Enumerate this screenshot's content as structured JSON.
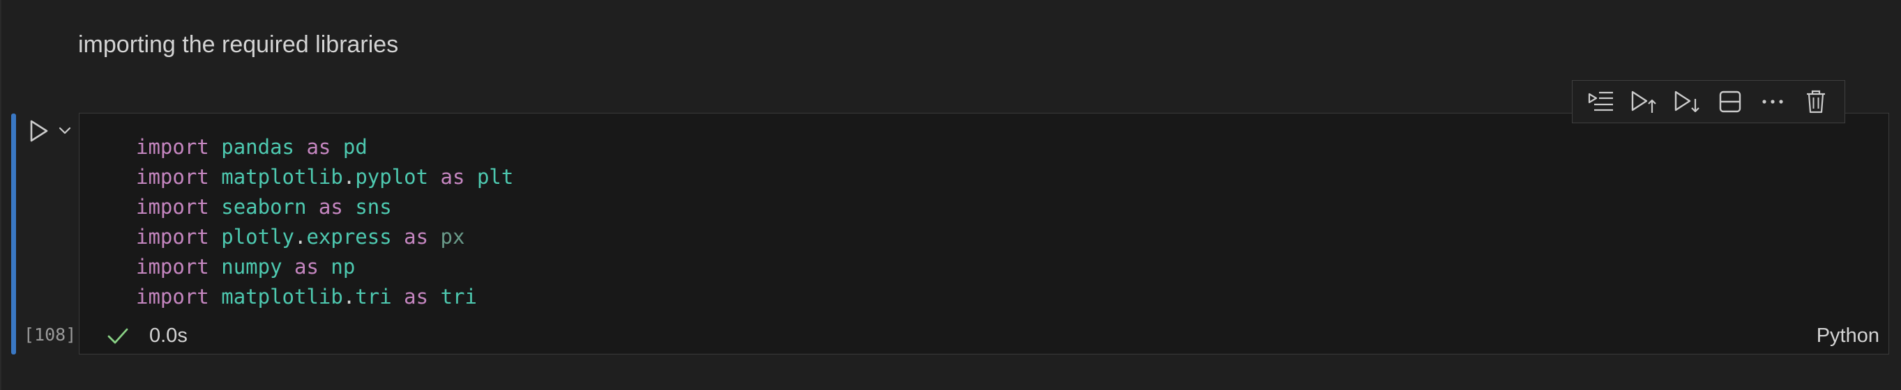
{
  "markdown": {
    "text": "importing the required libraries"
  },
  "code_cell": {
    "lines": [
      [
        {
          "t": "import",
          "c": "kw"
        },
        {
          "t": " ",
          "c": "punct"
        },
        {
          "t": "pandas",
          "c": "mod"
        },
        {
          "t": " ",
          "c": "punct"
        },
        {
          "t": "as",
          "c": "kw"
        },
        {
          "t": " ",
          "c": "punct"
        },
        {
          "t": "pd",
          "c": "mod"
        }
      ],
      [
        {
          "t": "import",
          "c": "kw"
        },
        {
          "t": " ",
          "c": "punct"
        },
        {
          "t": "matplotlib",
          "c": "mod"
        },
        {
          "t": ".",
          "c": "punct"
        },
        {
          "t": "pyplot",
          "c": "mod"
        },
        {
          "t": " ",
          "c": "punct"
        },
        {
          "t": "as",
          "c": "kw"
        },
        {
          "t": " ",
          "c": "punct"
        },
        {
          "t": "plt",
          "c": "mod"
        }
      ],
      [
        {
          "t": "import",
          "c": "kw"
        },
        {
          "t": " ",
          "c": "punct"
        },
        {
          "t": "seaborn",
          "c": "mod"
        },
        {
          "t": " ",
          "c": "punct"
        },
        {
          "t": "as",
          "c": "kw"
        },
        {
          "t": " ",
          "c": "punct"
        },
        {
          "t": "sns",
          "c": "mod"
        }
      ],
      [
        {
          "t": "import",
          "c": "kw"
        },
        {
          "t": " ",
          "c": "punct"
        },
        {
          "t": "plotly",
          "c": "mod"
        },
        {
          "t": ".",
          "c": "punct"
        },
        {
          "t": "express",
          "c": "mod"
        },
        {
          "t": " ",
          "c": "punct"
        },
        {
          "t": "as",
          "c": "kw"
        },
        {
          "t": " ",
          "c": "punct"
        },
        {
          "t": "px",
          "c": "dim"
        }
      ],
      [
        {
          "t": "import",
          "c": "kw"
        },
        {
          "t": " ",
          "c": "punct"
        },
        {
          "t": "numpy",
          "c": "mod"
        },
        {
          "t": " ",
          "c": "punct"
        },
        {
          "t": "as",
          "c": "kw"
        },
        {
          "t": " ",
          "c": "punct"
        },
        {
          "t": "np",
          "c": "mod"
        }
      ],
      [
        {
          "t": "import",
          "c": "kw"
        },
        {
          "t": " ",
          "c": "punct"
        },
        {
          "t": "matplotlib",
          "c": "mod"
        },
        {
          "t": ".",
          "c": "punct"
        },
        {
          "t": "tri",
          "c": "mod"
        },
        {
          "t": " ",
          "c": "punct"
        },
        {
          "t": "as",
          "c": "kw"
        },
        {
          "t": " ",
          "c": "punct"
        },
        {
          "t": "tri",
          "c": "mod"
        }
      ]
    ],
    "execution_count": "[108]",
    "status_icon": "check-icon",
    "execution_time": "0.0s",
    "language": "Python"
  },
  "run_controls": {
    "run_icon": "play-icon",
    "dropdown_icon": "chevron-down-icon"
  },
  "toolbar": {
    "buttons": [
      {
        "name": "run-by-line-button",
        "icon": "run-by-line-icon"
      },
      {
        "name": "execute-above-button",
        "icon": "execute-above-icon"
      },
      {
        "name": "execute-below-button",
        "icon": "execute-below-icon"
      },
      {
        "name": "split-cell-button",
        "icon": "split-cell-icon"
      },
      {
        "name": "more-actions-button",
        "icon": "ellipsis-icon"
      },
      {
        "name": "delete-cell-button",
        "icon": "trash-icon"
      }
    ]
  },
  "colors": {
    "background": "#1f1f1f",
    "editor_background": "#181818",
    "focus_bar": "#3a78c4",
    "keyword": "#c586c0",
    "module": "#4ec9b0",
    "success": "#89d185"
  }
}
